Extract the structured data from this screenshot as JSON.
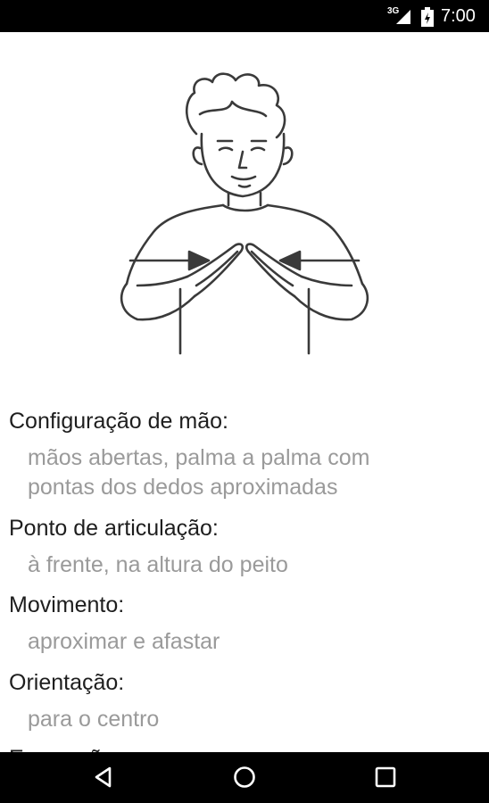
{
  "status_bar": {
    "network": "3G",
    "time": "7:00",
    "icons": [
      "signal-icon",
      "battery-charging-icon"
    ]
  },
  "sign": {
    "illustration": "person-signing-illustration",
    "fields": [
      {
        "label": "Configuração de mão:",
        "value": "mãos abertas, palma a palma com pontas dos dedos aproximadas"
      },
      {
        "label": "Ponto de articulação:",
        "value": "à frente, na altura do peito"
      },
      {
        "label": "Movimento:",
        "value": "aproximar e afastar"
      },
      {
        "label": "Orientação:",
        "value": "para o centro"
      },
      {
        "label": "Expressão:"
      }
    ]
  },
  "nav_bar": {
    "icons": [
      "back-icon",
      "home-icon",
      "recents-icon"
    ],
    "color": "#000000"
  }
}
